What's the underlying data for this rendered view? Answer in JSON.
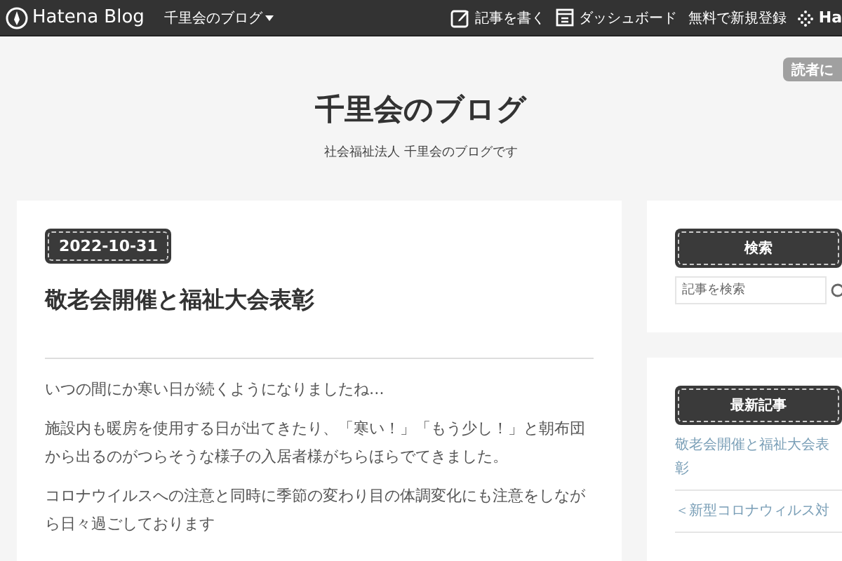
{
  "topbar": {
    "logo": "Hatena Blog",
    "blog_menu": "千里会のブログ",
    "write": "記事を書く",
    "dashboard": "ダッシュボード",
    "signup": "無料で新規登録",
    "brand": "Ha"
  },
  "subscribe": "読者に",
  "header": {
    "title": "千里会のブログ",
    "description": "社会福祉法人 千里会のブログです"
  },
  "post": {
    "date": "2022-10-31",
    "title": "敬老会開催と福祉大会表彰",
    "paragraphs": [
      "いつの間にか寒い日が続くようになりましたね…",
      "施設内も暖房を使用する日が出てきたり、「寒い！」「もう少し！」と朝布団から出るのがつらそうな様子の入居者様がちらほらでてきました。",
      "コロナウイルスへの注意と同時に季節の変わり目の体調変化にも注意をしながら日々過ごしております"
    ]
  },
  "sidebar": {
    "search": {
      "heading": "検索",
      "placeholder": "記事を検索"
    },
    "recent": {
      "heading": "最新記事",
      "items": [
        "敬老会開催と福祉大会表彰",
        "＜新型コロナウィルス対"
      ]
    }
  }
}
